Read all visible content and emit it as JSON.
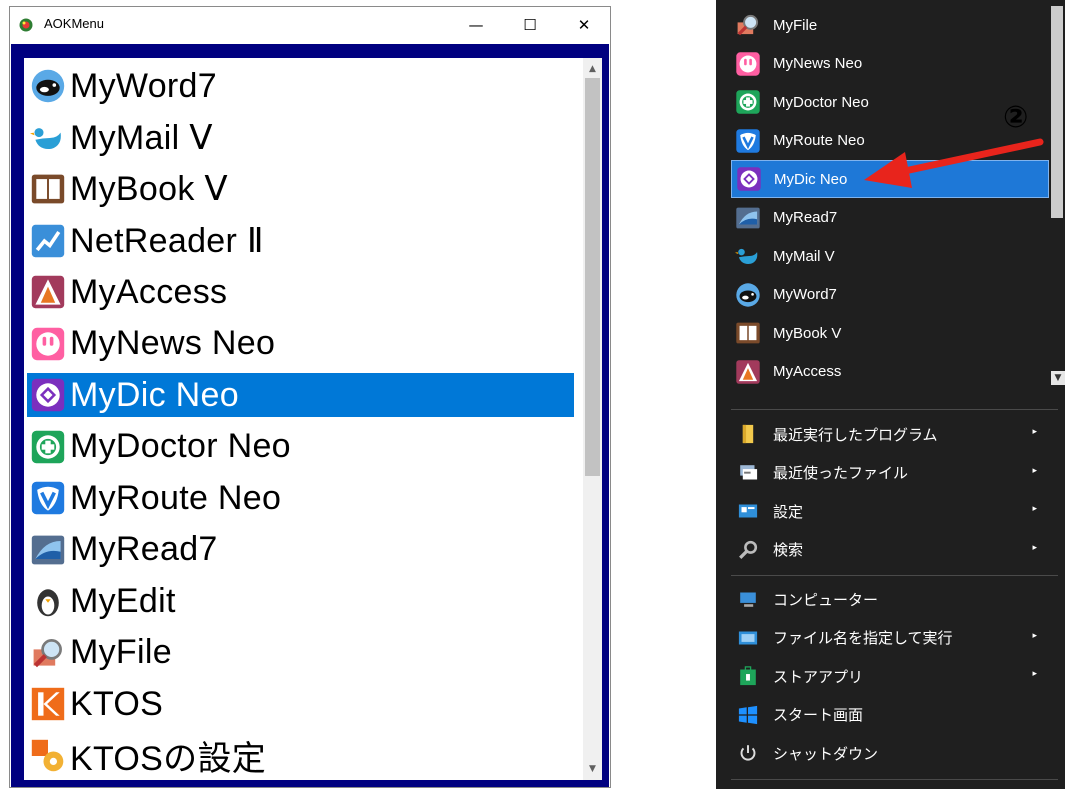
{
  "window": {
    "title": "AOKMenu",
    "minimize_glyph": "—",
    "maximize_glyph": "☐",
    "close_glyph": "✕"
  },
  "listbox": {
    "selected_index": 6,
    "items": [
      {
        "label": "MyWord7",
        "icon": "orca-icon"
      },
      {
        "label": "MyMail Ⅴ",
        "icon": "bird-icon"
      },
      {
        "label": "MyBook Ⅴ",
        "icon": "book-icon"
      },
      {
        "label": "NetReader Ⅱ",
        "icon": "chart-icon"
      },
      {
        "label": "MyAccess",
        "icon": "access-icon"
      },
      {
        "label": "MyNews Neo",
        "icon": "rabbit-icon"
      },
      {
        "label": "MyDic Neo",
        "icon": "dictionary-icon"
      },
      {
        "label": "MyDoctor Neo",
        "icon": "medical-cross-icon"
      },
      {
        "label": "MyRoute Neo",
        "icon": "route-shield-icon"
      },
      {
        "label": "MyRead7",
        "icon": "scanner-icon"
      },
      {
        "label": "MyEdit",
        "icon": "penguin-icon"
      },
      {
        "label": "MyFile",
        "icon": "magnifier-folder-icon"
      },
      {
        "label": "KTOS",
        "icon": "ktos-icon"
      },
      {
        "label": "KTOSの設定",
        "icon": "ktos-settings-icon"
      }
    ]
  },
  "start_menu": {
    "apps": [
      {
        "label": "MyFile",
        "icon": "magnifier-folder-icon"
      },
      {
        "label": "MyNews Neo",
        "icon": "rabbit-icon"
      },
      {
        "label": "MyDoctor Neo",
        "icon": "medical-cross-icon"
      },
      {
        "label": "MyRoute Neo",
        "icon": "route-shield-icon"
      },
      {
        "label": "MyDic Neo",
        "icon": "dictionary-icon"
      },
      {
        "label": "MyRead7",
        "icon": "scanner-icon"
      },
      {
        "label": "MyMail V",
        "icon": "bird-icon"
      },
      {
        "label": "MyWord7",
        "icon": "orca-icon"
      },
      {
        "label": "MyBook V",
        "icon": "book-icon"
      },
      {
        "label": "MyAccess",
        "icon": "access-icon"
      }
    ],
    "selected_index": 4,
    "system_items_1": [
      {
        "label": "最近実行したプログラム",
        "icon": "folder-icon",
        "arrow": "▸"
      },
      {
        "label": "最近使ったファイル",
        "icon": "recent-files-icon",
        "arrow": "▸"
      },
      {
        "label": "設定",
        "icon": "settings-panel-icon",
        "arrow": "▸"
      },
      {
        "label": "検索",
        "icon": "search-icon",
        "arrow": "▸"
      }
    ],
    "system_items_2": [
      {
        "label": "コンピューター",
        "icon": "computer-icon",
        "arrow": ""
      },
      {
        "label": "ファイル名を指定して実行",
        "icon": "run-icon",
        "arrow": "▸"
      },
      {
        "label": "ストアアプリ",
        "icon": "store-icon",
        "arrow": "▸"
      },
      {
        "label": "スタート画面",
        "icon": "windows-logo-icon",
        "arrow": ""
      },
      {
        "label": "シャットダウン",
        "icon": "power-icon",
        "arrow": ""
      }
    ]
  },
  "annotation": {
    "marker": "②",
    "arrow_color": "#e8241c"
  },
  "colors": {
    "selection": "#0078d7",
    "frame": "#000080",
    "start_bg": "#1f1f1f"
  }
}
